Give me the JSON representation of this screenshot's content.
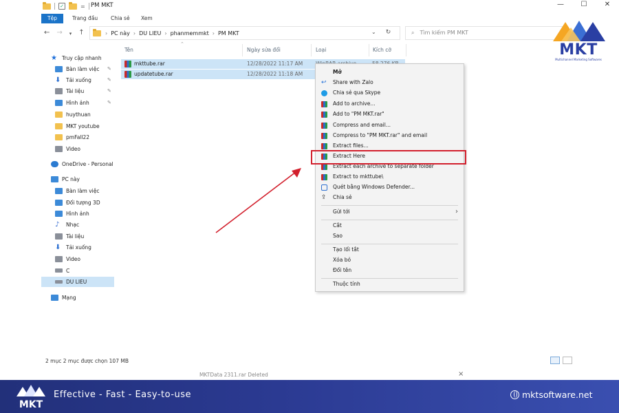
{
  "window": {
    "title": "PM MKT",
    "controls": [
      "—",
      "☐",
      "✕"
    ]
  },
  "ribbon": {
    "tabs": [
      "Tệp",
      "Trang đầu",
      "Chia sẻ",
      "Xem"
    ]
  },
  "address": {
    "crumbs": [
      "PC này",
      "DU LIEU",
      "phanmemmkt",
      "PM MKT"
    ],
    "search_placeholder": "Tìm kiếm PM MKT"
  },
  "sidebar": {
    "quick_access": "Truy cập nhanh",
    "quick_items": [
      "Bàn làm việc",
      "Tải xuống",
      "Tài liệu",
      "Hình ảnh",
      "huythuan",
      "MKT youtube",
      "pmFall22",
      "Video"
    ],
    "onedrive": "OneDrive - Personal",
    "pc": "PC này",
    "pc_items": [
      "Bàn làm việc",
      "Đối tượng 3D",
      "Hình ảnh",
      "Nhạc",
      "Tài liệu",
      "Tải xuống",
      "Video",
      "C",
      "DU LIEU"
    ],
    "network": "Mạng"
  },
  "files": {
    "headers": [
      "Tên",
      "Ngày sửa đổi",
      "Loại",
      "Kích cỡ"
    ],
    "rows": [
      {
        "name": "mkttube.rar",
        "date": "12/28/2022 11:17 AM",
        "type": "WinRAR archive",
        "size": "58,276 KB"
      },
      {
        "name": "updatetube.rar",
        "date": "12/28/2022 11:18 AM",
        "type": "",
        "size": ""
      }
    ]
  },
  "context_menu": {
    "items": [
      {
        "label": "Mở",
        "icon": "none",
        "bold": true
      },
      {
        "label": "Share with Zalo",
        "icon": "zalo-icon"
      },
      {
        "label": "Chia sẻ qua Skype",
        "icon": "skype-icon"
      },
      {
        "label": "Add to archive...",
        "icon": "winrar-icon"
      },
      {
        "label": "Add to \"PM MKT.rar\"",
        "icon": "winrar-icon"
      },
      {
        "label": "Compress and email...",
        "icon": "winrar-icon"
      },
      {
        "label": "Compress to \"PM MKT.rar\" and email",
        "icon": "winrar-icon"
      },
      {
        "label": "Extract files...",
        "icon": "winrar-icon"
      },
      {
        "label": "Extract Here",
        "icon": "winrar-icon"
      },
      {
        "label": "Extract each archive to separate folder",
        "icon": "winrar-icon"
      },
      {
        "label": "Extract to mkttube\\",
        "icon": "winrar-icon"
      },
      {
        "label": "Quét bằng Windows Defender...",
        "icon": "defender-icon"
      },
      {
        "label": "Chia sẻ",
        "icon": "share-icon"
      },
      {
        "label": "Gửi tới",
        "icon": "none",
        "submenu": true
      },
      {
        "label": "Cắt",
        "icon": "none"
      },
      {
        "label": "Sao",
        "icon": "none"
      },
      {
        "label": "Tạo lối tắt",
        "icon": "none"
      },
      {
        "label": "Xóa bỏ",
        "icon": "none"
      },
      {
        "label": "Đổi tên",
        "icon": "none"
      },
      {
        "label": "Thuộc tính",
        "icon": "none"
      }
    ],
    "highlighted": "Extract Here"
  },
  "status": {
    "text": "2 mục   2 mục được chọn  107 MB",
    "notification": "MKTData 2311.rar   Deleted"
  },
  "branding": {
    "logo_text": "MKT",
    "logo_sub": "Multichannel Marketing Softwares",
    "tagline": "Effective - Fast - Easy-to-use",
    "website": "mktsoftware.net"
  },
  "colors": {
    "accent": "#1a73c8",
    "selection": "#cce4f7",
    "highlight_box": "#d21f2c",
    "banner": "#2b3a92"
  }
}
